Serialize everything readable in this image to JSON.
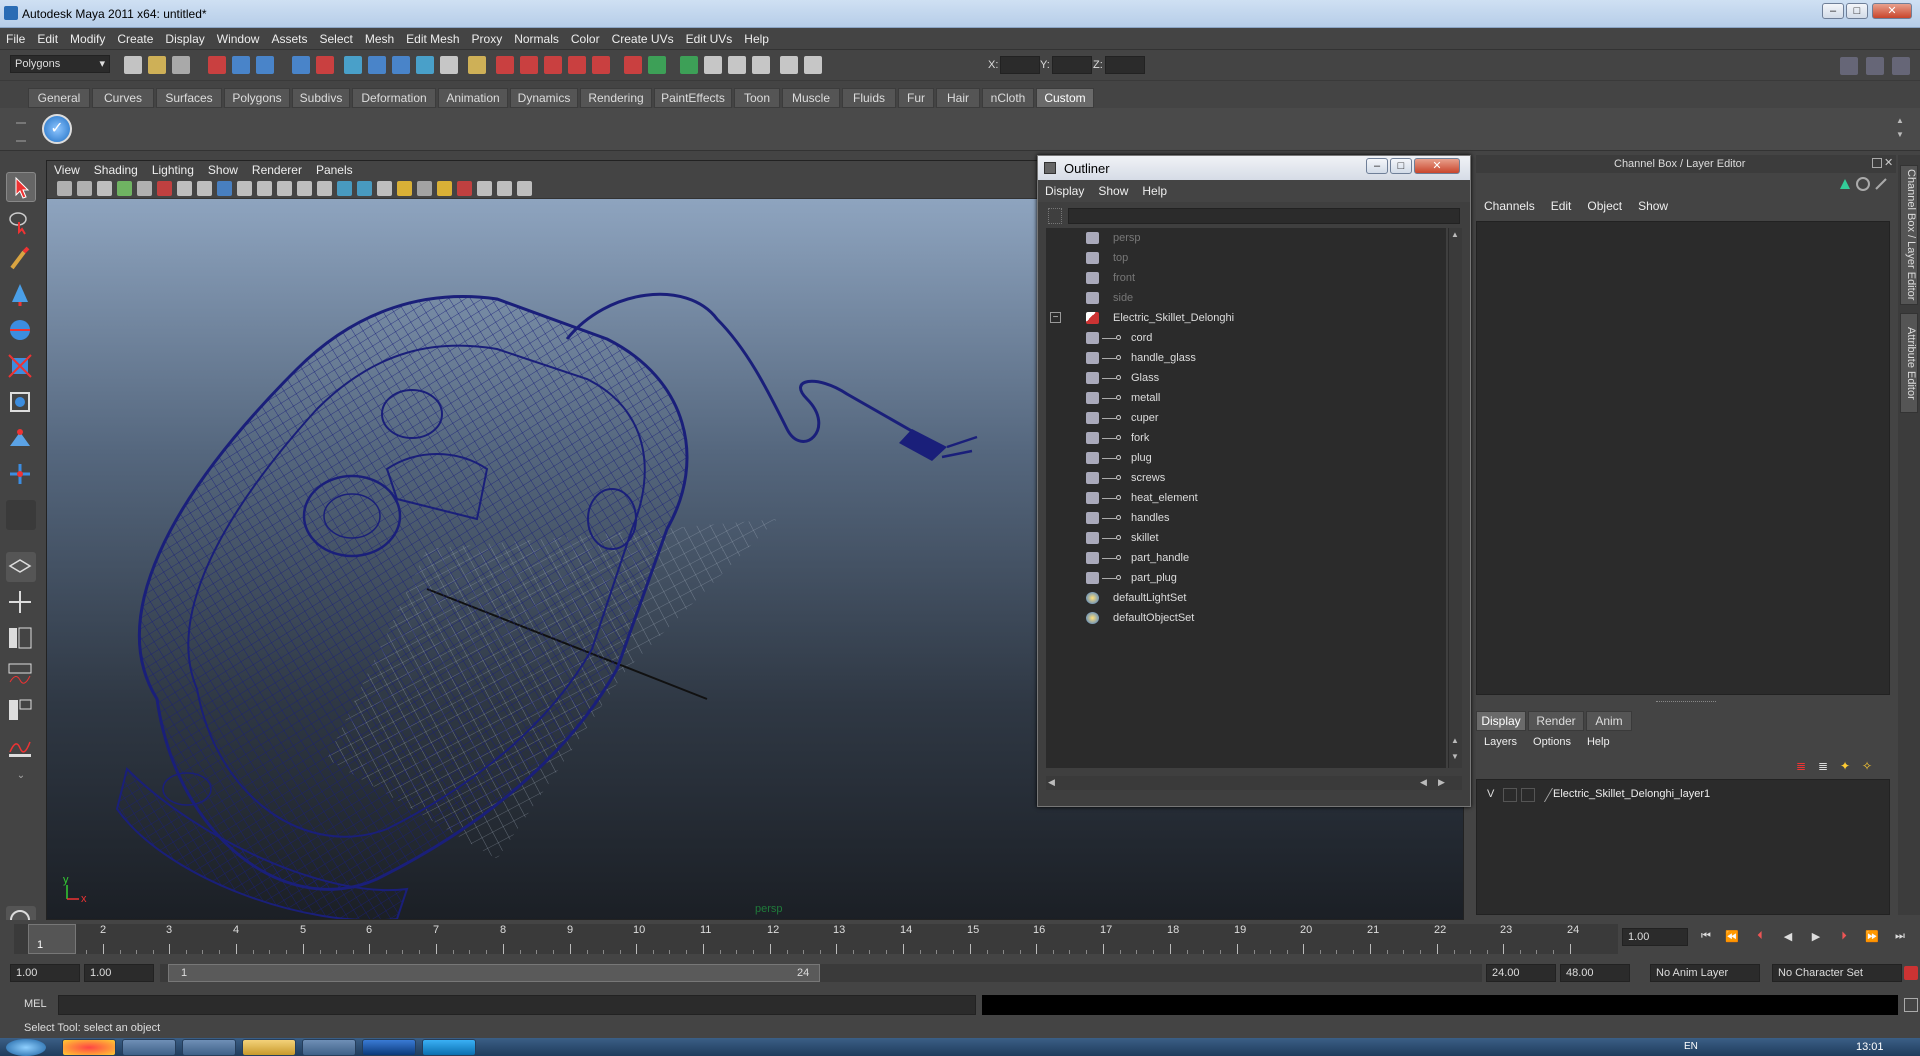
{
  "window": {
    "title": "Autodesk Maya 2011 x64: untitled*"
  },
  "menubar": [
    "File",
    "Edit",
    "Modify",
    "Create",
    "Display",
    "Window",
    "Assets",
    "Select",
    "Mesh",
    "Edit Mesh",
    "Proxy",
    "Normals",
    "Color",
    "Create UVs",
    "Edit UVs",
    "Help"
  ],
  "statusline": {
    "menuset": "Polygons",
    "x_label": "X:",
    "y_label": "Y:",
    "z_label": "Z:"
  },
  "shelf": {
    "tabs": [
      "General",
      "Curves",
      "Surfaces",
      "Polygons",
      "Subdivs",
      "Deformation",
      "Animation",
      "Dynamics",
      "Rendering",
      "PaintEffects",
      "Toon",
      "Muscle",
      "Fluids",
      "Fur",
      "Hair",
      "nCloth",
      "Custom"
    ],
    "active_tab": "Custom"
  },
  "viewport": {
    "menu": [
      "View",
      "Shading",
      "Lighting",
      "Show",
      "Renderer",
      "Panels"
    ],
    "camera_label": "persp",
    "axis_y": "y",
    "axis_x": "x"
  },
  "outliner": {
    "title": "Outliner",
    "menu": [
      "Display",
      "Show",
      "Help"
    ],
    "items": [
      {
        "label": "persp",
        "dim": true,
        "level": 0,
        "icon": "camera-icon"
      },
      {
        "label": "top",
        "dim": true,
        "level": 0,
        "icon": "camera-icon"
      },
      {
        "label": "front",
        "dim": true,
        "level": 0,
        "icon": "camera-icon"
      },
      {
        "label": "side",
        "dim": true,
        "level": 0,
        "icon": "camera-icon"
      },
      {
        "label": "Electric_Skillet_Delonghi",
        "dim": false,
        "level": 0,
        "icon": "group-icon",
        "expander": "−"
      },
      {
        "label": "cord",
        "dim": false,
        "level": 1,
        "icon": "mesh-icon"
      },
      {
        "label": "handle_glass",
        "dim": false,
        "level": 1,
        "icon": "mesh-icon"
      },
      {
        "label": "Glass",
        "dim": false,
        "level": 1,
        "icon": "mesh-icon"
      },
      {
        "label": "metall",
        "dim": false,
        "level": 1,
        "icon": "mesh-icon"
      },
      {
        "label": "cuper",
        "dim": false,
        "level": 1,
        "icon": "mesh-icon"
      },
      {
        "label": "fork",
        "dim": false,
        "level": 1,
        "icon": "mesh-icon"
      },
      {
        "label": "plug",
        "dim": false,
        "level": 1,
        "icon": "mesh-icon"
      },
      {
        "label": "screws",
        "dim": false,
        "level": 1,
        "icon": "mesh-icon"
      },
      {
        "label": "heat_element",
        "dim": false,
        "level": 1,
        "icon": "mesh-icon"
      },
      {
        "label": "handles",
        "dim": false,
        "level": 1,
        "icon": "mesh-icon"
      },
      {
        "label": "skillet",
        "dim": false,
        "level": 1,
        "icon": "mesh-icon"
      },
      {
        "label": "part_handle",
        "dim": false,
        "level": 1,
        "icon": "mesh-icon"
      },
      {
        "label": "part_plug",
        "dim": false,
        "level": 1,
        "icon": "mesh-icon"
      },
      {
        "label": "defaultLightSet",
        "dim": false,
        "level": 0,
        "icon": "set-icon"
      },
      {
        "label": "defaultObjectSet",
        "dim": false,
        "level": 0,
        "icon": "set-icon"
      }
    ]
  },
  "channelbox": {
    "header": "Channel Box / Layer Editor",
    "menu": [
      "Channels",
      "Edit",
      "Object",
      "Show"
    ],
    "layer_tabs": [
      "Display",
      "Render",
      "Anim"
    ],
    "layer_menu": [
      "Layers",
      "Options",
      "Help"
    ],
    "layers": [
      {
        "visible": "V",
        "name": "Electric_Skillet_Delonghi_layer1"
      }
    ]
  },
  "side_tabs": [
    "Channel Box / Layer Editor",
    "Attribute Editor"
  ],
  "timeline": {
    "ticks": [
      "1",
      "2",
      "3",
      "4",
      "5",
      "6",
      "7",
      "8",
      "9",
      "10",
      "11",
      "12",
      "13",
      "14",
      "15",
      "16",
      "17",
      "18",
      "19",
      "20",
      "21",
      "22",
      "23",
      "24"
    ],
    "current_frame": "1",
    "current_time_field": "1.00"
  },
  "range": {
    "start_time": "1.00",
    "start_range": "1.00",
    "slider_start": "1",
    "slider_end": "24",
    "end_range": "24.00",
    "end_time": "48.00",
    "anim_layer": "No Anim Layer",
    "char_set": "No Character Set"
  },
  "cmdline": {
    "label": "MEL"
  },
  "helpline": "Select Tool: select an object",
  "taskbar": {
    "clock": "13:01",
    "lang": "EN"
  },
  "colors": {
    "wireframe": "#1a1f7a",
    "accent": "#2a6cb4"
  }
}
